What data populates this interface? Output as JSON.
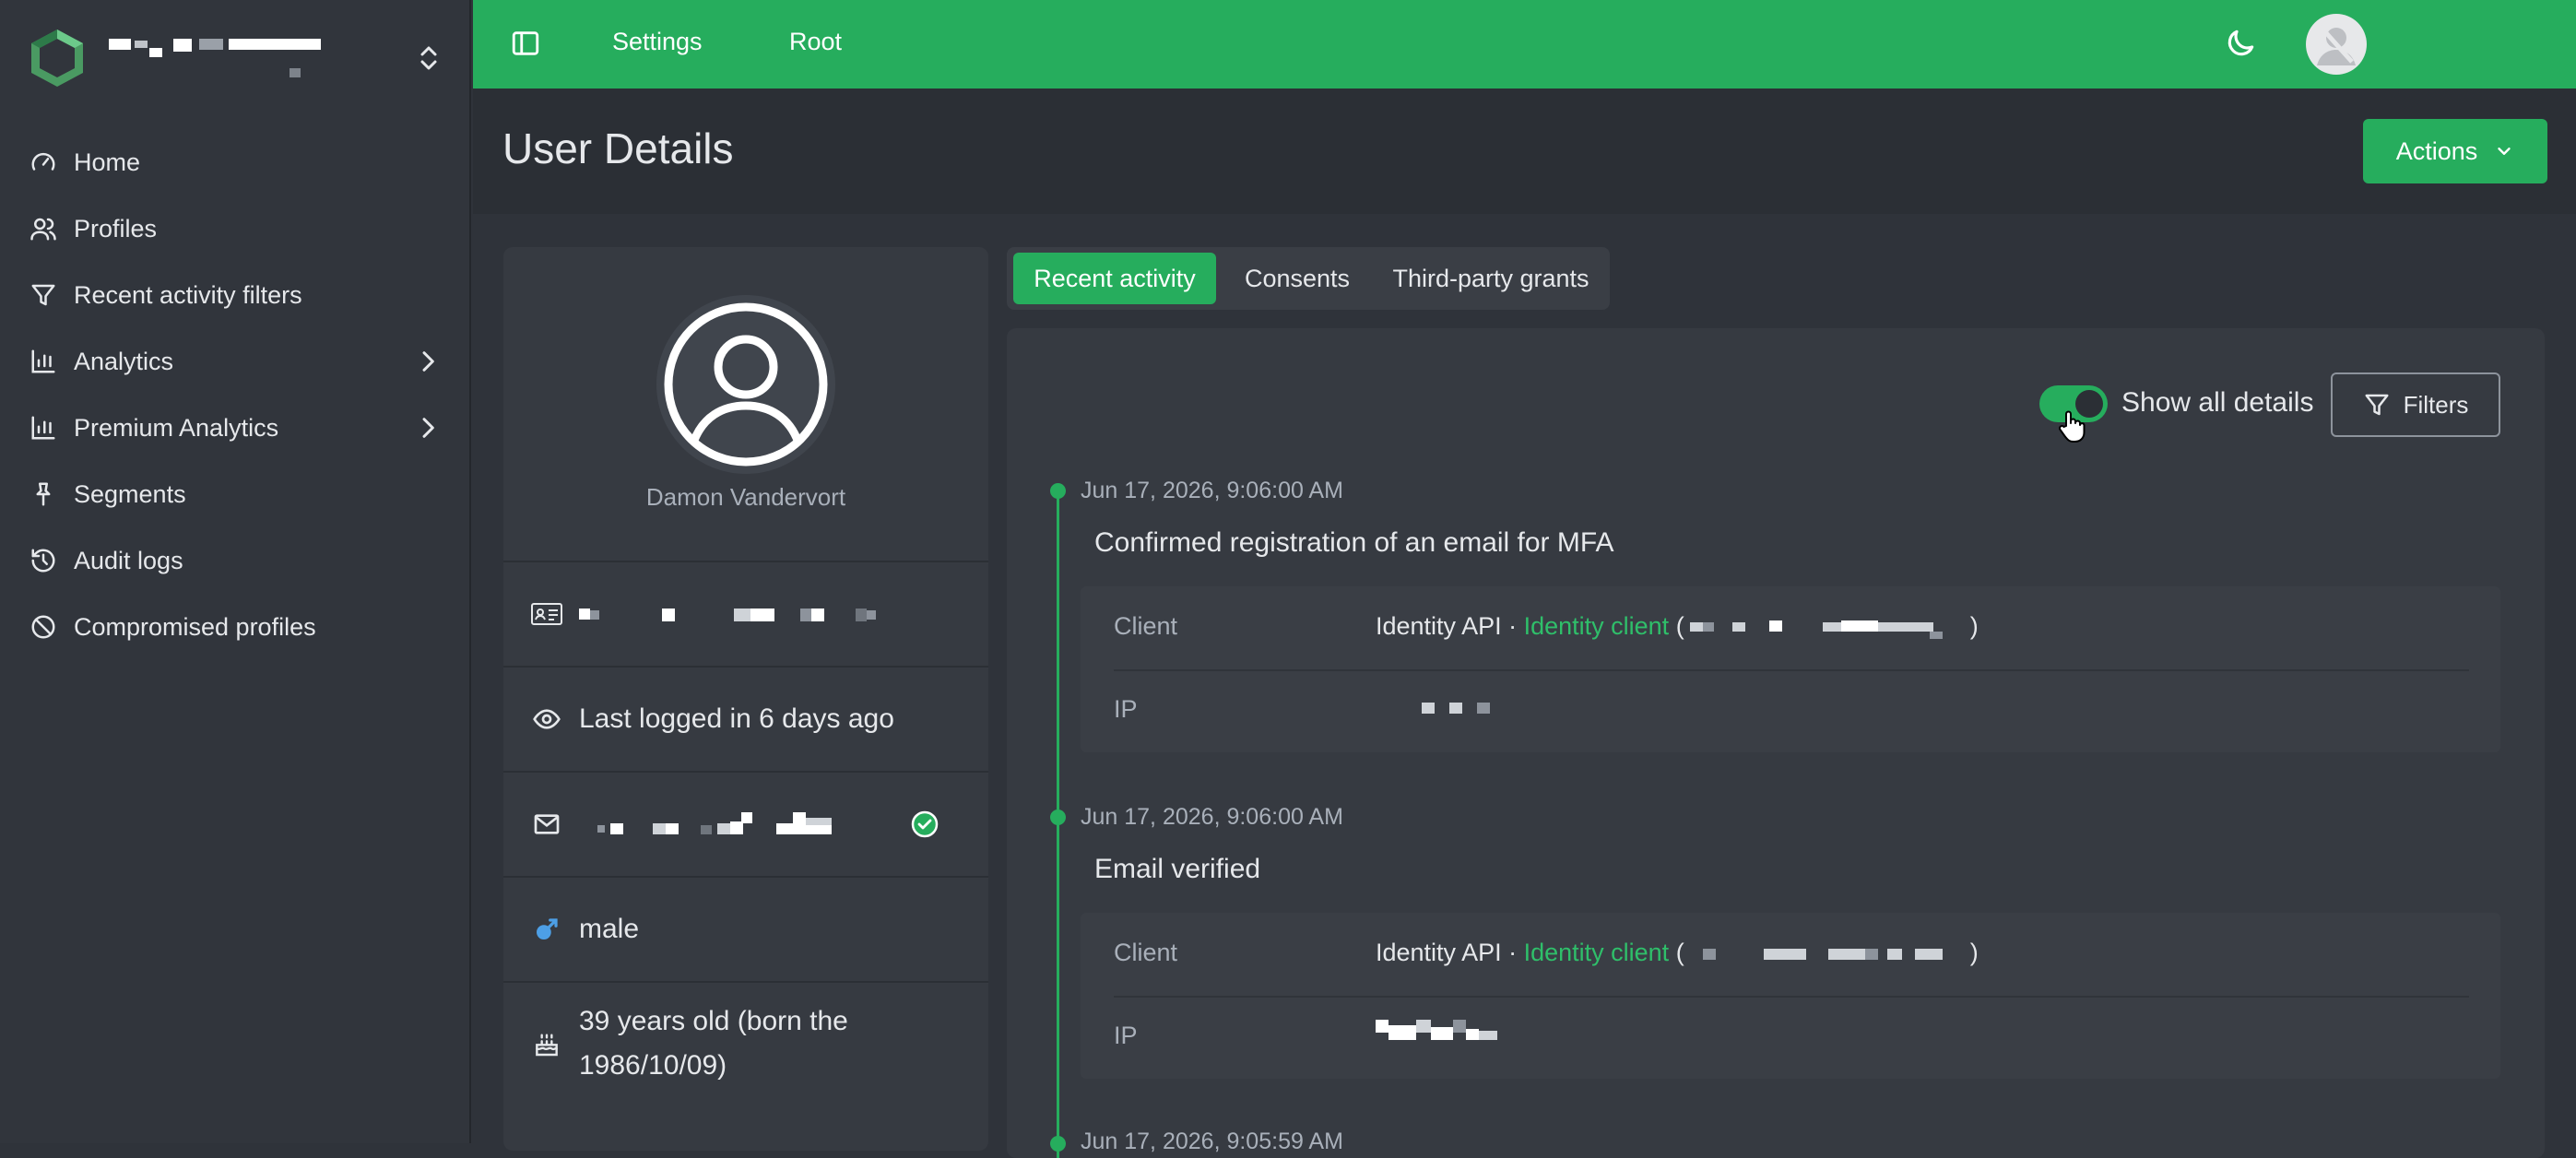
{
  "brand": {
    "logo_icon": "hexagon-logo-icon",
    "switch_icon": "chevron-updown-icon"
  },
  "sidebar": {
    "items": [
      {
        "label": "Home",
        "icon": "gauge-icon"
      },
      {
        "label": "Profiles",
        "icon": "users-icon"
      },
      {
        "label": "Recent activity filters",
        "icon": "filter-icon"
      },
      {
        "label": "Analytics",
        "icon": "bar-chart-icon",
        "has_submenu": true
      },
      {
        "label": "Premium Analytics",
        "icon": "bar-chart-icon",
        "has_submenu": true
      },
      {
        "label": "Segments",
        "icon": "pin-icon"
      },
      {
        "label": "Audit logs",
        "icon": "history-icon"
      },
      {
        "label": "Compromised profiles",
        "icon": "ban-icon"
      }
    ]
  },
  "topbar": {
    "links": [
      "Settings",
      "Root"
    ],
    "theme_icon": "moon-icon",
    "avatar_icon": "user-avatar-icon"
  },
  "header": {
    "title": "User Details",
    "actions_label": "Actions"
  },
  "profile": {
    "name": "Damon Vandervort",
    "last_login": "Last logged in 6 days ago",
    "gender": "male",
    "age_line1": "39 years old (born the",
    "age_line2": "1986/10/09)"
  },
  "tabs": [
    {
      "label": "Recent activity",
      "active": true
    },
    {
      "label": "Consents",
      "active": false
    },
    {
      "label": "Third-party grants",
      "active": false
    }
  ],
  "activity": {
    "show_all_details_label": "Show all details",
    "show_all_details_on": true,
    "filters_label": "Filters",
    "events": [
      {
        "time": "Jun 17, 2026, 9:06:00 AM",
        "title": "Confirmed registration of an email for MFA",
        "client_label": "Client",
        "client_api": "Identity API",
        "client_dot": " · ",
        "client_name": "Identity client",
        "open_paren": " (",
        "close_paren": ")",
        "ip_label": "IP"
      },
      {
        "time": "Jun 17, 2026, 9:06:00 AM",
        "title": "Email verified",
        "client_label": "Client",
        "client_api": "Identity API",
        "client_dot": " · ",
        "client_name": "Identity client",
        "open_paren": " (",
        "close_paren": ")",
        "ip_label": "IP"
      },
      {
        "time": "Jun 17, 2026, 9:05:59 AM"
      }
    ]
  },
  "colors": {
    "accent": "#26ad5d",
    "sidebar_bg": "#31353c",
    "main_bg": "#2f333a",
    "card_bg": "#363a41"
  }
}
